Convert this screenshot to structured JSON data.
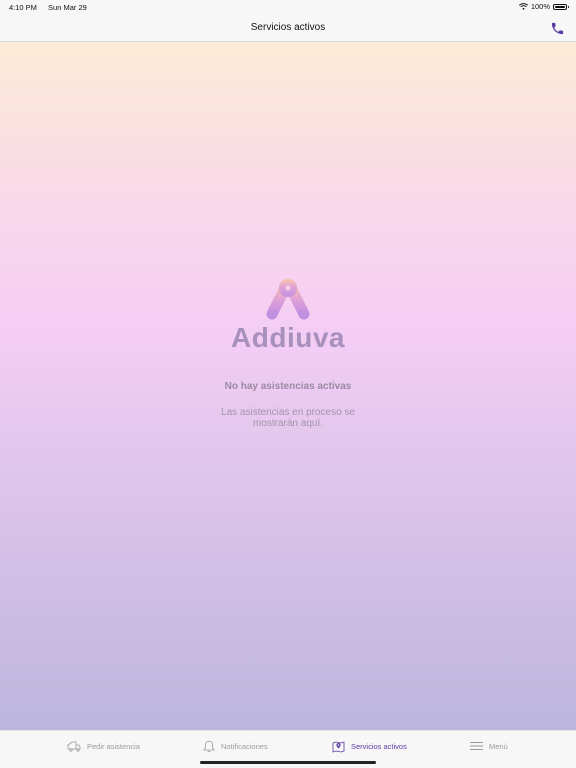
{
  "status_bar": {
    "time": "4:10 PM",
    "date": "Sun Mar 29",
    "battery": "100%"
  },
  "nav": {
    "title": "Servicios activos",
    "phone_icon": "phone-icon"
  },
  "empty_state": {
    "logo_text": "Addiuva",
    "title": "No hay asistencias activas",
    "subtitle": "Las asistencias en proceso se mostrarán aquí."
  },
  "tabs": [
    {
      "label": "Pedir asistencia",
      "icon": "truck-icon",
      "active": false
    },
    {
      "label": "Notificaciones",
      "icon": "bell-icon",
      "active": false
    },
    {
      "label": "Servicios activos",
      "icon": "map-pin-icon",
      "active": true
    },
    {
      "label": "Menú",
      "icon": "hamburger-menu-icon",
      "active": false
    }
  ],
  "colors": {
    "accent": "#5b3aa6",
    "inactive": "#9a9a9a",
    "logo_text": "#a890bd"
  }
}
